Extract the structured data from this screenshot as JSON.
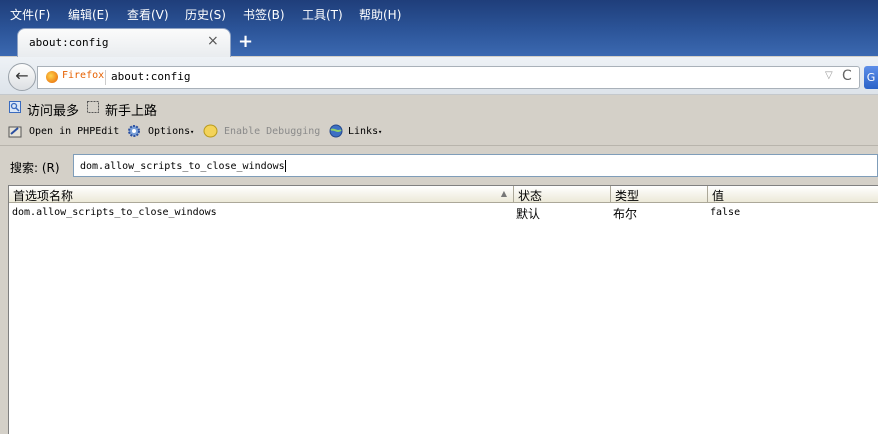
{
  "menubar": {
    "items": [
      "文件(F)",
      "编辑(E)",
      "查看(V)",
      "历史(S)",
      "书签(B)",
      "工具(T)",
      "帮助(H)"
    ]
  },
  "tab": {
    "title": "about:config",
    "close_glyph": "×",
    "new_tab_glyph": "+"
  },
  "navbar": {
    "back_glyph": "←",
    "identity_label": "Firefox",
    "url": "about:config",
    "dropdown_glyph": "▽",
    "reload_glyph": "C",
    "search_engine_glyph": "G"
  },
  "bookmarks": {
    "items": [
      "访问最多",
      "新手上路"
    ]
  },
  "toolbar2": {
    "open_in": "Open in PHPEdit",
    "options": "Options",
    "enable_debugging": "Enable Debugging",
    "links": "Links"
  },
  "search": {
    "label": "搜索: (R)",
    "value": "dom.allow_scripts_to_close_windows"
  },
  "table": {
    "headers": [
      "首选项名称",
      "状态",
      "类型",
      "值"
    ],
    "rows": [
      {
        "name": "dom.allow_scripts_to_close_windows",
        "status": "默认",
        "type": "布尔",
        "value": "false"
      }
    ]
  },
  "colors": {
    "menubar_bg": "#2b5397",
    "firefox_orange": "#e66000",
    "chrome_bg": "#d4d0c8"
  }
}
